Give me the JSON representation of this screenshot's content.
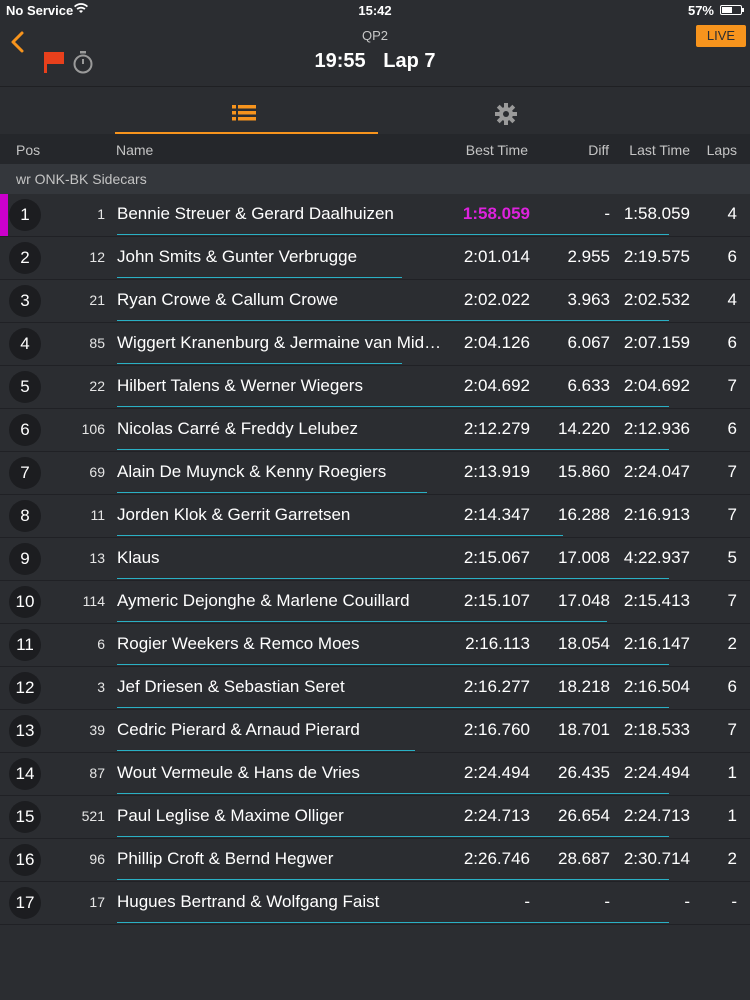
{
  "status": {
    "carrier": "No Service",
    "time": "15:42",
    "battery": "57%",
    "battery_level": 0.57
  },
  "header": {
    "session": "QP2",
    "remaining": "19:55",
    "lap": "Lap 7",
    "live_label": "LIVE"
  },
  "icons": {
    "back": "back-chevron-icon",
    "flag": "red-flag-icon",
    "stopwatch": "stopwatch-icon",
    "list": "list-icon",
    "settings": "gear-icon"
  },
  "colors": {
    "accent": "#f7941d",
    "fastest": "#dd22dd",
    "progress": "#2ab0c4",
    "flag": "#e8401c"
  },
  "columns": {
    "pos": "Pos",
    "name": "Name",
    "best": "Best Time",
    "diff": "Diff",
    "last": "Last Time",
    "laps": "Laps"
  },
  "group": "wr ONK-BK Sidecars",
  "rows": [
    {
      "pos": "1",
      "num": "1",
      "name": "Bennie Streuer & Gerard Daalhuizen",
      "best": "1:58.059",
      "diff": "-",
      "last": "1:58.059",
      "laps": "4",
      "fastest": true,
      "progress": 0.89
    },
    {
      "pos": "2",
      "num": "12",
      "name": "John Smits & Gunter Verbrugge",
      "best": "2:01.014",
      "diff": "2.955",
      "last": "2:19.575",
      "laps": "6",
      "progress": 0.46
    },
    {
      "pos": "3",
      "num": "21",
      "name": "Ryan Crowe & Callum Crowe",
      "best": "2:02.022",
      "diff": "3.963",
      "last": "2:02.532",
      "laps": "4",
      "progress": 0.89
    },
    {
      "pos": "4",
      "num": "85",
      "name": "Wiggert Kranenburg & Jermaine van Middegaal",
      "best": "2:04.126",
      "diff": "6.067",
      "last": "2:07.159",
      "laps": "6",
      "progress": 0.46
    },
    {
      "pos": "5",
      "num": "22",
      "name": "Hilbert Talens & Werner Wiegers",
      "best": "2:04.692",
      "diff": "6.633",
      "last": "2:04.692",
      "laps": "7",
      "progress": 0.89
    },
    {
      "pos": "6",
      "num": "106",
      "name": "Nicolas Carré & Freddy Lelubez",
      "best": "2:12.279",
      "diff": "14.220",
      "last": "2:12.936",
      "laps": "6",
      "progress": 0.89
    },
    {
      "pos": "7",
      "num": "69",
      "name": "Alain De Muynck & Kenny Roegiers",
      "best": "2:13.919",
      "diff": "15.860",
      "last": "2:24.047",
      "laps": "7",
      "progress": 0.5
    },
    {
      "pos": "8",
      "num": "11",
      "name": "Jorden Klok & Gerrit Garretsen",
      "best": "2:14.347",
      "diff": "16.288",
      "last": "2:16.913",
      "laps": "7",
      "progress": 0.72
    },
    {
      "pos": "9",
      "num": "13",
      "name": "Klaus",
      "best": "2:15.067",
      "diff": "17.008",
      "last": "4:22.937",
      "laps": "5",
      "progress": 0.89
    },
    {
      "pos": "10",
      "num": "114",
      "name": "Aymeric Dejonghe & Marlene Couillard",
      "best": "2:15.107",
      "diff": "17.048",
      "last": "2:15.413",
      "laps": "7",
      "progress": 0.79
    },
    {
      "pos": "11",
      "num": "6",
      "name": "Rogier Weekers & Remco Moes",
      "best": "2:16.113",
      "diff": "18.054",
      "last": "2:16.147",
      "laps": "2",
      "progress": 0.89
    },
    {
      "pos": "12",
      "num": "3",
      "name": "Jef Driesen & Sebastian Seret",
      "best": "2:16.277",
      "diff": "18.218",
      "last": "2:16.504",
      "laps": "6",
      "progress": 0.89
    },
    {
      "pos": "13",
      "num": "39",
      "name": "Cedric Pierard & Arnaud Pierard",
      "best": "2:16.760",
      "diff": "18.701",
      "last": "2:18.533",
      "laps": "7",
      "progress": 0.48
    },
    {
      "pos": "14",
      "num": "87",
      "name": "Wout Vermeule & Hans de Vries",
      "best": "2:24.494",
      "diff": "26.435",
      "last": "2:24.494",
      "laps": "1",
      "progress": 0.89
    },
    {
      "pos": "15",
      "num": "521",
      "name": "Paul Leglise & Maxime Olliger",
      "best": "2:24.713",
      "diff": "26.654",
      "last": "2:24.713",
      "laps": "1",
      "progress": 0.89
    },
    {
      "pos": "16",
      "num": "96",
      "name": "Phillip Croft & Bernd Hegwer",
      "best": "2:26.746",
      "diff": "28.687",
      "last": "2:30.714",
      "laps": "2",
      "progress": 0.89
    },
    {
      "pos": "17",
      "num": "17",
      "name": "Hugues Bertrand & Wolfgang Faist",
      "best": "-",
      "diff": "-",
      "last": "-",
      "laps": "-",
      "progress": 0.89
    }
  ]
}
